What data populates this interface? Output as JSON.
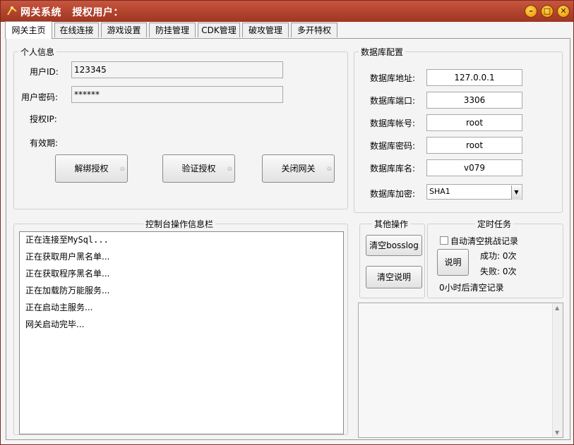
{
  "window": {
    "app_name": "网关系统",
    "user_label": "授权用户：",
    "controls": {
      "minimize": "–",
      "maximize": "□",
      "close": "✕"
    }
  },
  "tabs": [
    "网关主页",
    "在线连接",
    "游戏设置",
    "防挂管理",
    "CDK管理",
    "破攻管理",
    "多开特权"
  ],
  "personal": {
    "title": "个人信息",
    "user_id_label": "用户ID:",
    "user_id_value": "123345",
    "password_label": "用户密码:",
    "password_value": "******",
    "auth_ip_label": "授权IP:",
    "expiry_label": "有效期:",
    "buttons": {
      "unbind": "解绑授权",
      "verify": "验证授权",
      "close_gateway": "关闭网关"
    }
  },
  "database": {
    "title": "数据库配置",
    "address_label": "数据库地址:",
    "address_value": "127.0.0.1",
    "port_label": "数据库端口:",
    "port_value": "3306",
    "account_label": "数据库帐号:",
    "account_value": "root",
    "password_label": "数据库密码:",
    "password_value": "root",
    "name_label": "数据库库名:",
    "name_value": "v079",
    "encrypt_label": "数据库加密:",
    "encrypt_value": "SHA1"
  },
  "console": {
    "title": "控制台操作信息栏",
    "lines": [
      "正在连接至MySql...",
      "正在获取用户黑名单...",
      "正在获取程序黑名单...",
      "正在加载防万能服务...",
      "正在启动主服务...",
      "网关启动完毕..."
    ]
  },
  "other_ops": {
    "title": "其他操作",
    "clear_bosslog": "清空bosslog",
    "clear_desc": "清空说明"
  },
  "scheduled": {
    "title": "定时任务",
    "auto_clear_label": "自动清空挑战记录",
    "explain_button": "说明",
    "success_label": "成功: 0次",
    "fail_label": "失败: 0次",
    "clear_after": "0小时后清空记录"
  },
  "colors": {
    "titlebar": "#b2442e",
    "title_text": "#ffffff",
    "window_controls": "#f7a500"
  }
}
